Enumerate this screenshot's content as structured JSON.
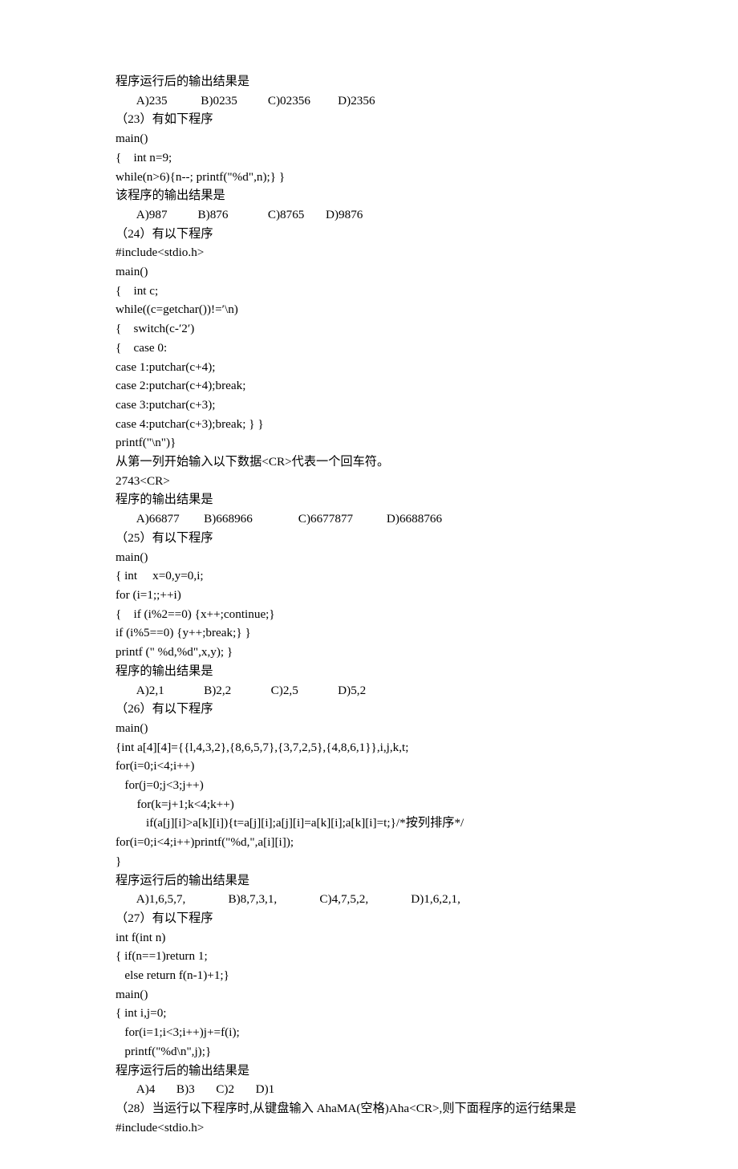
{
  "lines": [
    {
      "text": "程序运行后的输出结果是"
    },
    {
      "text": "       A)235           B)0235          C)02356         D)2356"
    },
    {
      "text": "（23）有如下程序"
    },
    {
      "text": "main()"
    },
    {
      "text": "{    int n=9;"
    },
    {
      "text": "while(n>6){n--; printf(\"%d\",n);} }"
    },
    {
      "text": "该程序的输出结果是"
    },
    {
      "text": "       A)987          B)876             C)8765       D)9876"
    },
    {
      "text": "（24）有以下程序"
    },
    {
      "text": "#include<stdio.h>"
    },
    {
      "text": "main()"
    },
    {
      "text": "{    int c;"
    },
    {
      "text": "while((c=getchar())!=′\\n)"
    },
    {
      "text": "{    switch(c-′2′)"
    },
    {
      "text": "{    case 0:"
    },
    {
      "text": "case 1:putchar(c+4);"
    },
    {
      "text": "case 2:putchar(c+4);break;"
    },
    {
      "text": "case 3:putchar(c+3);"
    },
    {
      "text": "case 4:putchar(c+3);break; } }"
    },
    {
      "text": "printf(\"\\n\")}"
    },
    {
      "text": "从第一列开始输入以下数据<CR>代表一个回车符。"
    },
    {
      "text": "2743<CR>"
    },
    {
      "text": "程序的输出结果是"
    },
    {
      "text": "       A)66877        B)668966               C)6677877           D)6688766"
    },
    {
      "text": "（25）有以下程序"
    },
    {
      "text": "main()"
    },
    {
      "text": "{ int     x=0,y=0,i;"
    },
    {
      "text": "for (i=1;;++i)"
    },
    {
      "text": "{    if (i%2==0) {x++;continue;}"
    },
    {
      "text": "if (i%5==0) {y++;break;} }"
    },
    {
      "text": "printf (\" %d,%d\",x,y); }"
    },
    {
      "text": "程序的输出结果是"
    },
    {
      "text": "       A)2,1             B)2,2             C)2,5             D)5,2"
    },
    {
      "text": "（26）有以下程序"
    },
    {
      "text": "main()"
    },
    {
      "text": "{int a[4][4]={{l,4,3,2},{8,6,5,7},{3,7,2,5},{4,8,6,1}},i,j,k,t;"
    },
    {
      "text": "for(i=0;i<4;i++)"
    },
    {
      "text": "   for(j=0;j<3;j++)"
    },
    {
      "text": "       for(k=j+1;k<4;k++)"
    },
    {
      "text": "          if(a[j][i]>a[k][i]){t=a[j][i];a[j][i]=a[k][i];a[k][i]=t;}/*按列排序*/"
    },
    {
      "text": "for(i=0;i<4;i++)printf(\"%d,\",a[i][i]);"
    },
    {
      "text": "}"
    },
    {
      "text": "程序运行后的输出结果是"
    },
    {
      "text": "       A)1,6,5,7,              B)8,7,3,1,              C)4,7,5,2,              D)1,6,2,1,"
    },
    {
      "text": "（27）有以下程序"
    },
    {
      "text": "int f(int n)"
    },
    {
      "text": "{ if(n==1)return 1;"
    },
    {
      "text": "   else return f(n-1)+1;}"
    },
    {
      "text": "main()"
    },
    {
      "text": "{ int i,j=0;"
    },
    {
      "text": "   for(i=1;i<3;i++)j+=f(i);"
    },
    {
      "text": "   printf(\"%d\\n\",j);}"
    },
    {
      "text": "程序运行后的输出结果是"
    },
    {
      "text": "       A)4       B)3       C)2       D)1"
    },
    {
      "text": "（28）当运行以下程序时,从键盘输入 AhaMA(空格)Aha<CR>,则下面程序的运行结果是"
    },
    {
      "text": "#include<stdio.h>"
    }
  ]
}
